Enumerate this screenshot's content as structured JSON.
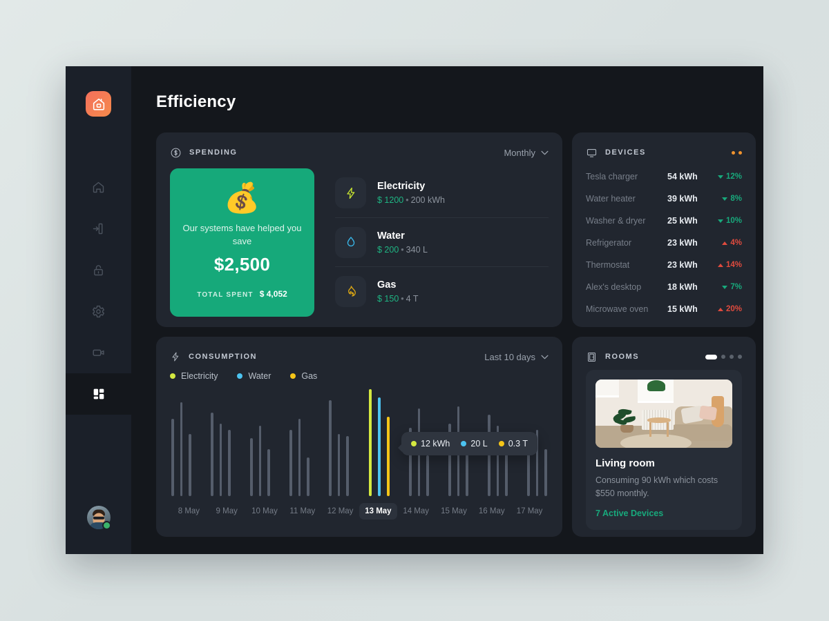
{
  "app": {
    "logo_icon": "smart-home-icon",
    "page_title": "Efficiency"
  },
  "sidebar": {
    "items": [
      {
        "icon": "home-icon",
        "name": "home"
      },
      {
        "icon": "login-door-icon",
        "name": "access"
      },
      {
        "icon": "lock-icon",
        "name": "security"
      },
      {
        "icon": "gear-icon",
        "name": "settings"
      },
      {
        "icon": "video-camera-icon",
        "name": "cameras"
      },
      {
        "icon": "dashboard-grid-icon",
        "name": "dashboard",
        "active": true
      }
    ],
    "avatar": {
      "name": "user-avatar",
      "status": "online"
    }
  },
  "spending": {
    "icon": "dollar-circle-icon",
    "title": "SPENDING",
    "period": "Monthly",
    "save_card": {
      "emoji": "money-bag-emoji",
      "message": "Our systems have helped you save",
      "amount": "$2,500",
      "total_label": "TOTAL SPENT",
      "total_value": "$ 4,052"
    },
    "utilities": [
      {
        "icon": "bolt-icon",
        "name": "Electricity",
        "price": "$ 1200",
        "usage": "200 kWh",
        "color": "#c6e331"
      },
      {
        "icon": "water-drop-icon",
        "name": "Water",
        "price": "$ 200",
        "usage": "340 L",
        "color": "#38b6e8"
      },
      {
        "icon": "flame-icon",
        "name": "Gas",
        "price": "$ 150",
        "usage": "4 T",
        "color": "#d9a514"
      }
    ]
  },
  "devices": {
    "icon": "monitor-icon",
    "title": "DEVICES",
    "menu_icon": "two-dots-icon",
    "rows": [
      {
        "name": "Tesla charger",
        "value": "54 kWh",
        "delta": "12%",
        "dir": "down"
      },
      {
        "name": "Water heater",
        "value": "39 kWh",
        "delta": "8%",
        "dir": "down"
      },
      {
        "name": "Washer & dryer",
        "value": "25 kWh",
        "delta": "10%",
        "dir": "down"
      },
      {
        "name": "Refrigerator",
        "value": "23 kWh",
        "delta": "4%",
        "dir": "up"
      },
      {
        "name": "Thermostat",
        "value": "23 kWh",
        "delta": "14%",
        "dir": "up"
      },
      {
        "name": "Alex's desktop",
        "value": "18 kWh",
        "delta": "7%",
        "dir": "down"
      },
      {
        "name": "Microwave oven",
        "value": "15 kWh",
        "delta": "20%",
        "dir": "up"
      }
    ]
  },
  "consumption": {
    "icon": "bolt-icon",
    "title": "CONSUMPTION",
    "period": "Last 10 days",
    "legend": [
      {
        "label": "Electricity",
        "color": "#d4e840"
      },
      {
        "label": "Water",
        "color": "#4cc3f0"
      },
      {
        "label": "Gas",
        "color": "#f5c518"
      }
    ],
    "tooltip": [
      {
        "label": "12 kWh",
        "color": "#d4e840"
      },
      {
        "label": "20 L",
        "color": "#4cc3f0"
      },
      {
        "label": "0.3 T",
        "color": "#f5c518"
      }
    ],
    "selected_day": "13 May"
  },
  "rooms": {
    "icon": "door-icon",
    "title": "ROOMS",
    "pager": {
      "pages": 4,
      "current": 1
    },
    "card": {
      "photo": "living-room-photo",
      "name": "Living room",
      "description": "Consuming 90 kWh which costs $550 monthly.",
      "link": "7 Active Devices"
    }
  },
  "chart_data": {
    "type": "bar",
    "title": "CONSUMPTION",
    "xlabel": "",
    "ylabel": "",
    "grid": false,
    "legend_position": "top-left",
    "categories": [
      "8 May",
      "9 May",
      "10 May",
      "11 May",
      "12 May",
      "13 May",
      "14 May",
      "15 May",
      "16 May",
      "17 May"
    ],
    "series": [
      {
        "name": "Electricity",
        "color": "#d4e840",
        "values": [
          72,
          78,
          54,
          62,
          90,
          100,
          64,
          68,
          76,
          50
        ]
      },
      {
        "name": "Water",
        "color": "#4cc3f0",
        "values": [
          88,
          68,
          66,
          72,
          58,
          92,
          82,
          84,
          66,
          62
        ]
      },
      {
        "name": "Gas",
        "color": "#f5c518",
        "values": [
          58,
          62,
          44,
          36,
          56,
          74,
          38,
          52,
          48,
          44
        ]
      }
    ],
    "highlighted_category": "13 May",
    "tooltip_values": {
      "Electricity": "12 kWh",
      "Water": "20 L",
      "Gas": "0.3 T"
    }
  }
}
